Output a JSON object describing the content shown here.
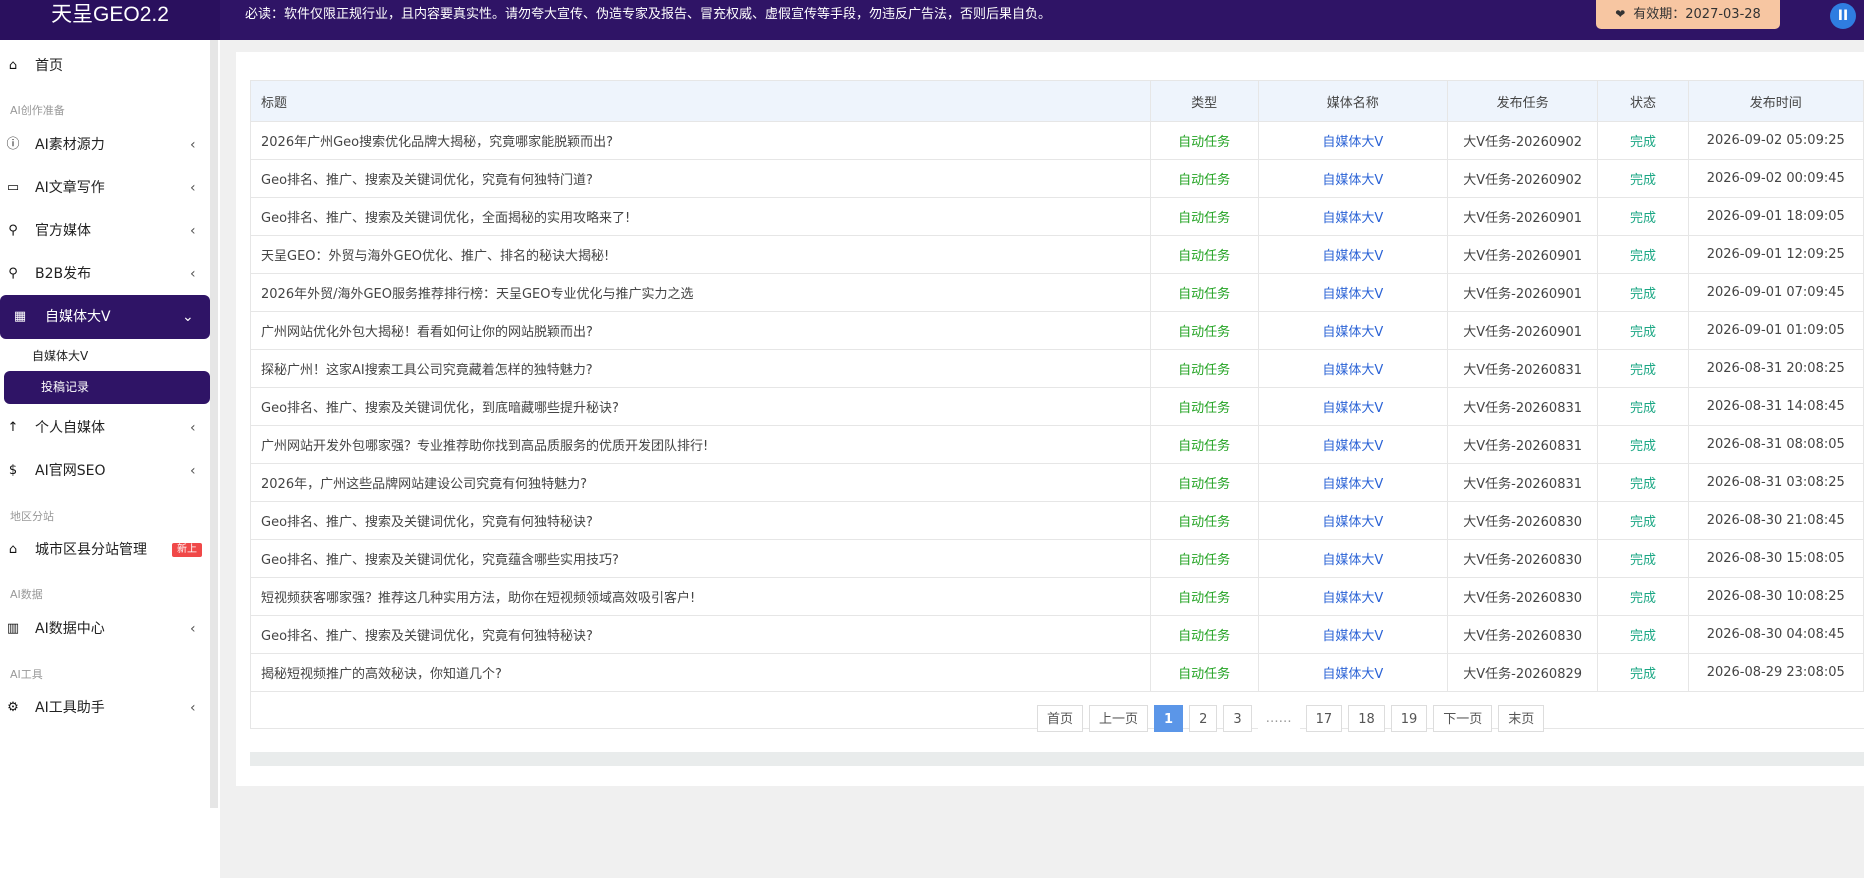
{
  "header": {
    "brand": "天呈GEO2.2",
    "notice": "必读：软件仅限正规行业，且内容要真实性。请勿夸大宣传、伪造专家及报告、冒充权威、虚假宣传等手段，勿违反广告法，否则后果自负。",
    "expiry": "有效期：2027-03-28"
  },
  "sidebar": {
    "home": "首页",
    "section_ai_create": "AI创作准备",
    "material": "AI素材源力",
    "article": "AI文章写作",
    "official_media": "官方媒体",
    "b2b": "B2B发布",
    "bigv": "自媒体大V",
    "bigv_sub1": "自媒体大V",
    "bigv_sub2": "投稿记录",
    "personal_media": "个人自媒体",
    "seo": "AI官网SEO",
    "section_region": "地区分站",
    "city_branch": "城市区县分站管理",
    "city_badge": "新上",
    "section_data": "AI数据",
    "data_center": "AI数据中心",
    "section_tools": "AI工具",
    "tools_helper": "AI工具助手"
  },
  "table": {
    "headers": [
      "标题",
      "类型",
      "媒体名称",
      "发布任务",
      "状态",
      "发布时间"
    ],
    "rows": [
      [
        "2026年广州Geo搜索优化品牌大揭秘，究竟哪家能脱颖而出?",
        "自动任务",
        "自媒体大V",
        "大V任务-20260902",
        "完成",
        "2026-09-02 05:09:25"
      ],
      [
        "Geo排名、推广、搜索及关键词优化，究竟有何独特门道?",
        "自动任务",
        "自媒体大V",
        "大V任务-20260902",
        "完成",
        "2026-09-02 00:09:45"
      ],
      [
        "Geo排名、推广、搜索及关键词优化，全面揭秘的实用攻略来了!",
        "自动任务",
        "自媒体大V",
        "大V任务-20260901",
        "完成",
        "2026-09-01 18:09:05"
      ],
      [
        "天呈GEO：外贸与海外GEO优化、推广、排名的秘诀大揭秘!",
        "自动任务",
        "自媒体大V",
        "大V任务-20260901",
        "完成",
        "2026-09-01 12:09:25"
      ],
      [
        "2026年外贸/海外GEO服务推荐排行榜：天呈GEO专业优化与推广实力之选",
        "自动任务",
        "自媒体大V",
        "大V任务-20260901",
        "完成",
        "2026-09-01 07:09:45"
      ],
      [
        "广州网站优化外包大揭秘！看看如何让你的网站脱颖而出?",
        "自动任务",
        "自媒体大V",
        "大V任务-20260901",
        "完成",
        "2026-09-01 01:09:05"
      ],
      [
        "探秘广州！这家AI搜索工具公司究竟藏着怎样的独特魅力?",
        "自动任务",
        "自媒体大V",
        "大V任务-20260831",
        "完成",
        "2026-08-31 20:08:25"
      ],
      [
        "Geo排名、推广、搜索及关键词优化，到底暗藏哪些提升秘诀?",
        "自动任务",
        "自媒体大V",
        "大V任务-20260831",
        "完成",
        "2026-08-31 14:08:45"
      ],
      [
        "广州网站开发外包哪家强？专业推荐助你找到高品质服务的优质开发团队排行!",
        "自动任务",
        "自媒体大V",
        "大V任务-20260831",
        "完成",
        "2026-08-31 08:08:05"
      ],
      [
        "2026年，广州这些品牌网站建设公司究竟有何独特魅力?",
        "自动任务",
        "自媒体大V",
        "大V任务-20260831",
        "完成",
        "2026-08-31 03:08:25"
      ],
      [
        "Geo排名、推广、搜索及关键词优化，究竟有何独特秘诀?",
        "自动任务",
        "自媒体大V",
        "大V任务-20260830",
        "完成",
        "2026-08-30 21:08:45"
      ],
      [
        "Geo排名、推广、搜索及关键词优化，究竟蕴含哪些实用技巧?",
        "自动任务",
        "自媒体大V",
        "大V任务-20260830",
        "完成",
        "2026-08-30 15:08:05"
      ],
      [
        "短视频获客哪家强？推荐这几种实用方法，助你在短视频领域高效吸引客户!",
        "自动任务",
        "自媒体大V",
        "大V任务-20260830",
        "完成",
        "2026-08-30 10:08:25"
      ],
      [
        "Geo排名、推广、搜索及关键词优化，究竟有何独特秘诀?",
        "自动任务",
        "自媒体大V",
        "大V任务-20260830",
        "完成",
        "2026-08-30 04:08:45"
      ],
      [
        "揭秘短视频推广的高效秘诀，你知道几个?",
        "自动任务",
        "自媒体大V",
        "大V任务-20260829",
        "完成",
        "2026-08-29 23:08:05"
      ]
    ]
  },
  "pager": {
    "first": "首页",
    "prev": "上一页",
    "pages": [
      "1",
      "2",
      "3"
    ],
    "dots": "……",
    "tail_pages": [
      "17",
      "18",
      "19"
    ],
    "next": "下一页",
    "last": "末页"
  }
}
